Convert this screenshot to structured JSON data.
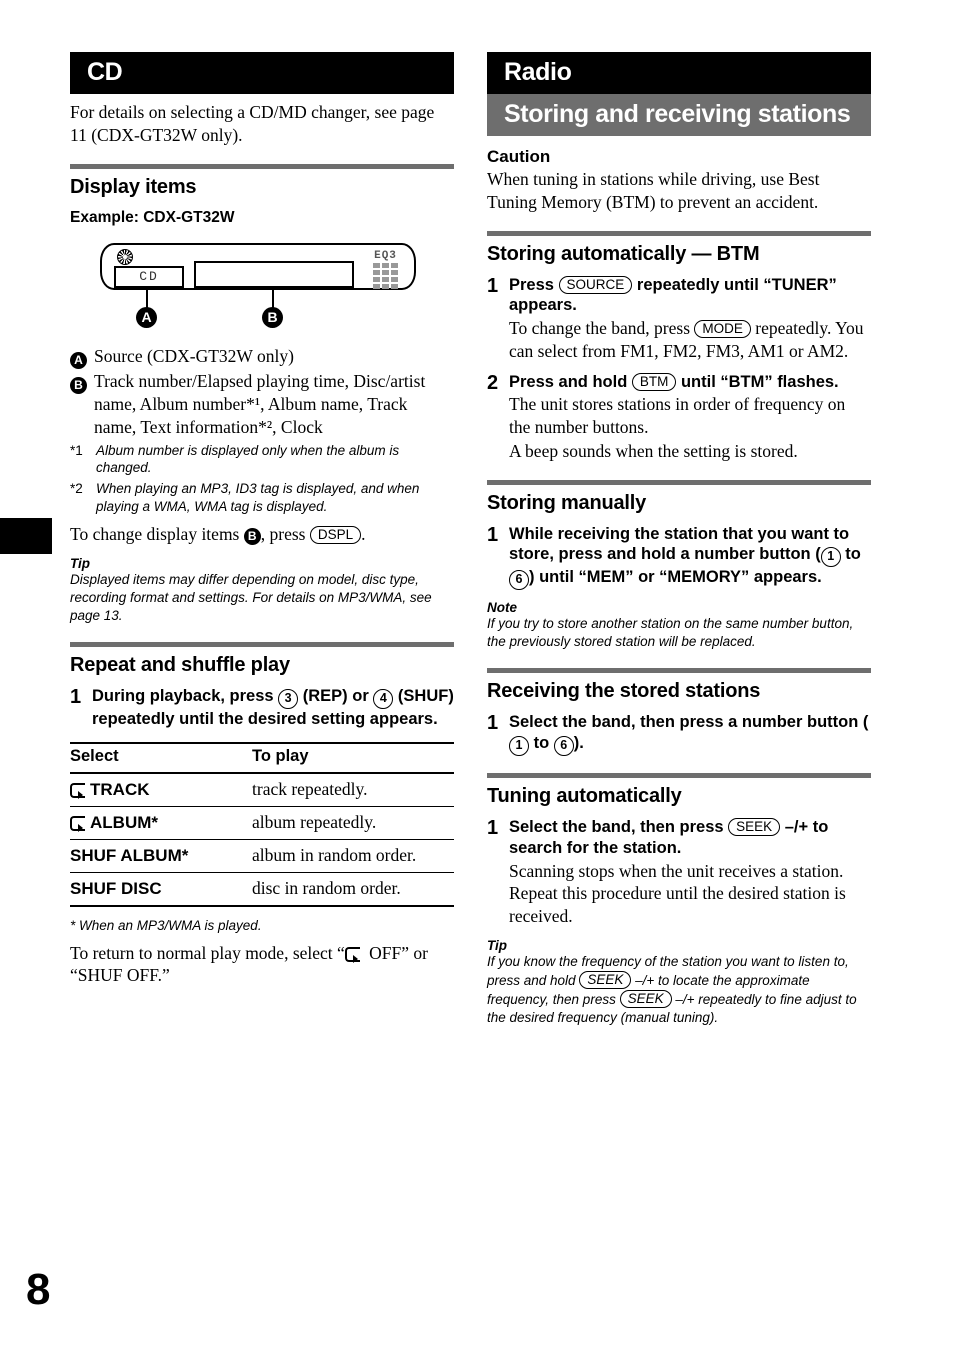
{
  "page": {
    "number": "8",
    "tab_marker": true,
    "accent_gray": "#6e6e6e",
    "accent_black": "#000000"
  },
  "left_column": {
    "chapter_title": "CD",
    "intro": "For details on selecting a CD/MD changer, see page 11 (CDX-GT32W only).",
    "display_items": {
      "heading": "Display items",
      "example_label": "Example: CDX-GT32W",
      "device": {
        "disc_icon": "disc-icon",
        "segment_a_text": "CD",
        "eq_label": "EQ3",
        "marker_a": "A",
        "marker_b": "B"
      },
      "callouts": [
        {
          "key": "A",
          "text": "Source (CDX-GT32W only)"
        },
        {
          "key": "B",
          "text": "Track number/Elapsed playing time, Disc/artist name, Album number*¹, Album name, Track name, Text information*², Clock"
        }
      ],
      "footnotes": [
        {
          "mark": "*1",
          "text": "Album number is displayed only when the album is changed."
        },
        {
          "mark": "*2",
          "text": "When playing an MP3, ID3 tag is displayed, and when playing a WMA, WMA tag is displayed."
        }
      ],
      "change_text_before": "To change display items ",
      "change_text_mid": ", press ",
      "change_key": "DSPL",
      "change_text_after": ".",
      "tip_head": "Tip",
      "tip_body": "Displayed items may differ depending on model, disc type, recording format and settings. For details on MP3/WMA, see page 13."
    },
    "repeat_shuffle": {
      "heading": "Repeat and shuffle play",
      "step_number": "1",
      "step_text_1": "During playback, press ",
      "step_key_1": "3",
      "step_text_2": " (REP) or ",
      "step_key_2": "4",
      "step_text_3": " (SHUF) repeatedly until the desired setting appears.",
      "table": {
        "headers": [
          "Select",
          "To play"
        ],
        "rows": [
          {
            "icon": "repeat-icon",
            "select": "TRACK",
            "star": "",
            "play": "track repeatedly."
          },
          {
            "icon": "repeat-icon",
            "select": "ALBUM",
            "star": "*",
            "play": "album repeatedly."
          },
          {
            "icon": "",
            "select": "SHUF ALBUM",
            "star": "*",
            "play": "album in random order."
          },
          {
            "icon": "",
            "select": "SHUF DISC",
            "star": "",
            "play": "disc in random order."
          }
        ]
      },
      "table_footnote": "* When an MP3/WMA is played.",
      "return_text_1": "To return to normal play mode, select “",
      "return_text_2": " OFF” or “SHUF OFF.”"
    }
  },
  "right_column": {
    "chapter_title": "Radio",
    "subchapter_title": "Storing and receiving stations",
    "caution": {
      "heading": "Caution",
      "body": "When tuning in stations while driving, use Best Tuning Memory (BTM) to prevent an accident."
    },
    "storing_automatically": {
      "heading": "Storing automatically — BTM",
      "steps": [
        {
          "number": "1",
          "title_1": "Press ",
          "key": "SOURCE",
          "title_2": " repeatedly until “TUNER” appears.",
          "desc_1": "To change the band, press ",
          "desc_key": "MODE",
          "desc_2": " repeatedly. You can select from FM1, FM2, FM3, AM1 or AM2."
        },
        {
          "number": "2",
          "title_1": "Press and hold ",
          "key": "BTM",
          "title_2": " until “BTM” flashes.",
          "desc_1": "The unit stores stations in order of frequency on the number buttons.",
          "desc_2": "A beep sounds when the setting is stored."
        }
      ]
    },
    "storing_manually": {
      "heading": "Storing manually",
      "step_number": "1",
      "title_1": "While receiving the station that you want to store, press and hold a number button (",
      "key_1": "1",
      "title_2": " to ",
      "key_2": "6",
      "title_3": ") until “MEM” or “MEMORY” appears.",
      "note_head": "Note",
      "note_body": "If you try to store another station on the same number button, the previously stored station will be replaced."
    },
    "receiving_stored": {
      "heading": "Receiving the stored stations",
      "step_number": "1",
      "title_1": "Select the band, then press a number button (",
      "key_1": "1",
      "title_2": " to ",
      "key_2": "6",
      "title_3": ")."
    },
    "tuning_automatically": {
      "heading": "Tuning automatically",
      "step_number": "1",
      "title_1": "Select the band, then press ",
      "key": "SEEK",
      "title_2": " –/+ to search for the station.",
      "desc": "Scanning stops when the unit receives a station. Repeat this procedure until the desired station is received.",
      "tip_head": "Tip",
      "tip_1": "If you know the frequency of the station you want to listen to, press and hold ",
      "tip_key_1": "SEEK",
      "tip_2": " –/+ to locate the approximate frequency, then press ",
      "tip_key_2": "SEEK",
      "tip_3": " –/+ repeatedly to fine adjust to the desired frequency (manual tuning)."
    }
  }
}
